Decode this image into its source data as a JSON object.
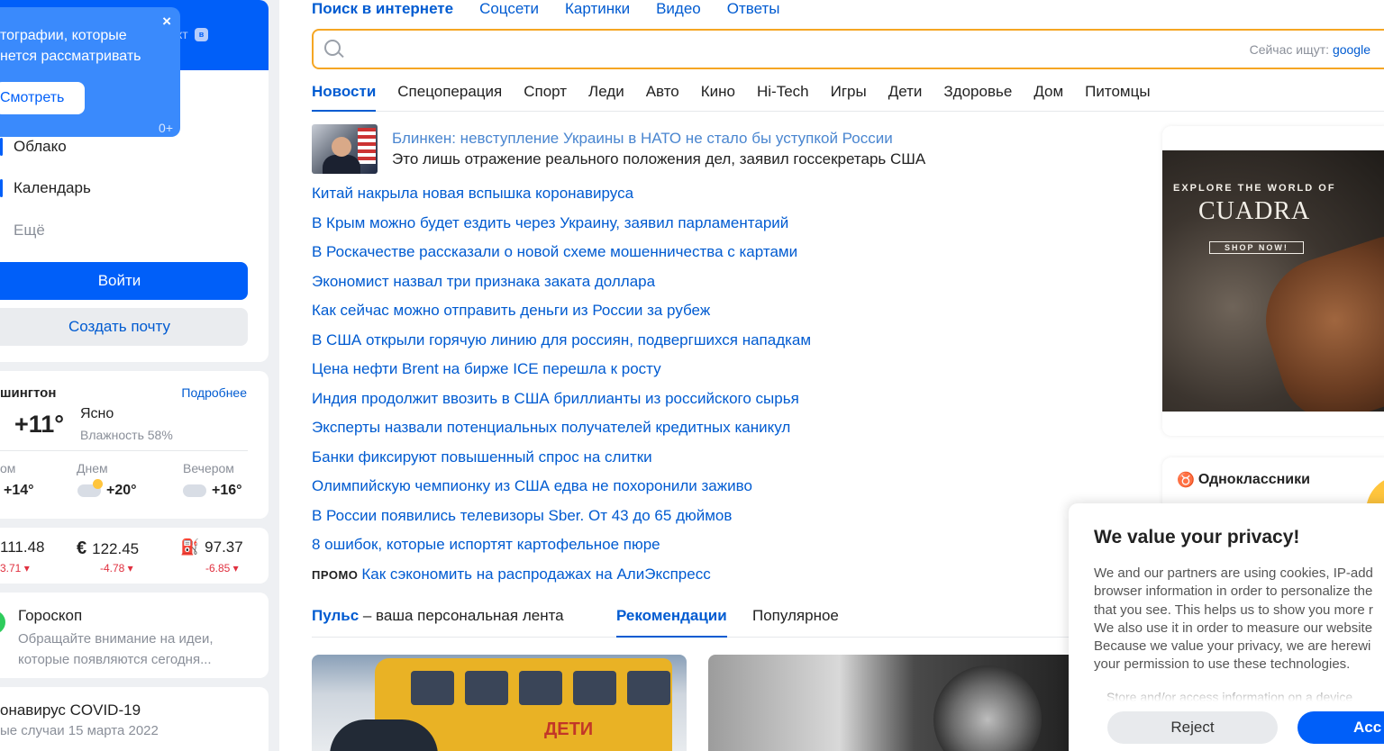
{
  "left": {
    "popup": {
      "text_line1": "тографии, которые",
      "text_line2": "нется рассматривать",
      "button": "Смотреть",
      "close": "×",
      "age": "0+"
    },
    "header_ext": "кт",
    "menu": {
      "cloud": "Облако",
      "calendar": "Календарь",
      "more": "Ещё"
    },
    "login_button": "Войти",
    "create_mail_button": "Создать почту",
    "weather": {
      "city": "шингтон",
      "more_link": "Подробнее",
      "temp": "+11°",
      "condition": "Ясно",
      "humidity": "Влажность 58%",
      "periods": [
        {
          "label": "ом",
          "value": "+14°"
        },
        {
          "label": "Днем",
          "value": "+20°"
        },
        {
          "label": "Вечером",
          "value": "+16°"
        }
      ]
    },
    "currency": [
      {
        "symbol": "",
        "value": "111.48",
        "delta": "3.71 ▾"
      },
      {
        "symbol": "€",
        "value": "122.45",
        "delta": "-4.78 ▾"
      },
      {
        "symbol": "⛽",
        "value": "97.37",
        "delta": "-6.85 ▾"
      }
    ],
    "horoscope": {
      "title": "Гороскоп",
      "text": "Обращайте внимание на идеи, которые появляются сегодня..."
    },
    "covid": {
      "title": "онавирус COVID-19",
      "subtitle": "ые случаи 15 марта 2022"
    }
  },
  "search": {
    "tabs": [
      "Поиск в интернете",
      "Соцсети",
      "Картинки",
      "Видео",
      "Ответы"
    ],
    "hint_label": "Сейчас ищут:",
    "hint_query": "google"
  },
  "news_tabs": [
    "Новости",
    "Спецоперация",
    "Спорт",
    "Леди",
    "Авто",
    "Кино",
    "Hi-Tech",
    "Игры",
    "Дети",
    "Здоровье",
    "Дом",
    "Питомцы"
  ],
  "lead": {
    "title": "Блинкен: невступление Украины в НАТО не стало бы уступкой России",
    "subtitle": "Это лишь отражение реального положения дел, заявил госсекретарь США"
  },
  "news": [
    "Китай накрыла новая вспышка коронавируса",
    "В Крым можно будет ездить через Украину, заявил парламентарий",
    "В Роскачестве рассказали о новой схеме мошенничества с картами",
    "Экономист назвал три признака заката доллара",
    "Как сейчас можно отправить деньги из России за рубеж",
    "В США открыли горячую линию для россиян, подвергшихся нападкам",
    "Цена нефти Brent на бирже ICE перешла к росту",
    "Индия продолжит ввозить в США бриллианты из российского сырья",
    "Эксперты назвали потенциальных получателей кредитных каникул",
    "Банки фиксируют повышенный спрос на слитки",
    "Олимпийскую чемпионку из США едва не похоронили заживо",
    "В России появились телевизоры Sber. От 43 до 65 дюймов",
    "8 ошибок, которые испортят картофельное пюре"
  ],
  "promo": {
    "label": "ПРОМО",
    "text": "Как сэкономить на распродажах на АлиЭкспресс"
  },
  "pulse": {
    "title": "Пульс",
    "tagline": " – ваша персональная лента",
    "tab_recommend": "Рекомендации",
    "tab_popular": "Популярное"
  },
  "cards": {
    "bus_text": "ДЕТИ"
  },
  "ad": {
    "line1": "EXPLORE THE WORLD OF",
    "brand": "CUADRA",
    "cta": "SHOP NOW!"
  },
  "ok": {
    "title": "Одноклассники"
  },
  "privacy": {
    "title": "We value your privacy!",
    "body": "We and our partners are using cookies, IP-add\nbrowser information in order to personalize the\nthat you see. This helps us to show you more r\nWe also use it in order to measure our website\nBecause we value your privacy, we are herewi\nyour permission to use these technologies.",
    "store": "Store and/or access information on a device",
    "reject": "Reject",
    "accept": "Acc"
  }
}
